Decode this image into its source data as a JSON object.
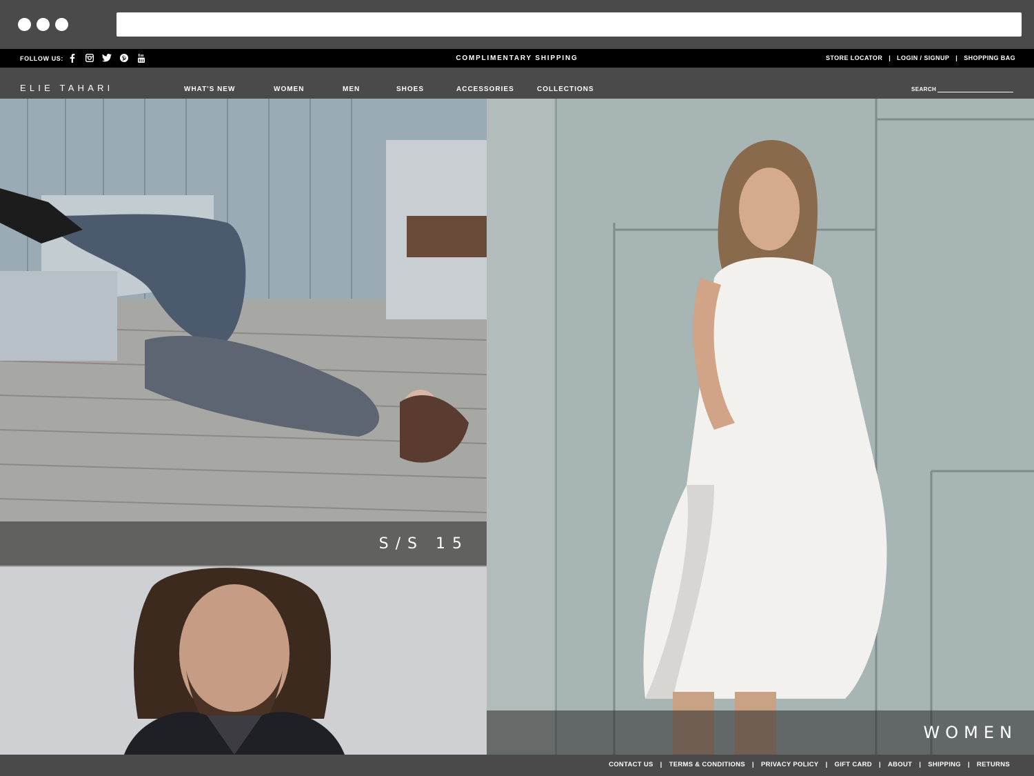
{
  "topbar": {
    "follow_label": "FOLLOW US:",
    "social_icons": [
      "facebook-icon",
      "instagram-icon",
      "twitter-icon",
      "pinterest-icon",
      "youtube-icon"
    ],
    "promo": "COMPLIMENTARY SHIPPING",
    "links": [
      "STORE LOCATOR",
      "LOGIN / SIGNUP",
      "SHOPPING BAG"
    ]
  },
  "header": {
    "logo": "ELIE TAHARI",
    "nav": [
      "WHAT'S NEW",
      "WOMEN",
      "MEN",
      "SHOES",
      "ACCESSORIES",
      "COLLECTIONS"
    ],
    "search_label": "SEARCH"
  },
  "panels": {
    "ss15": "S/S 15",
    "women": "WOMEN"
  },
  "footer": {
    "links": [
      "CONTACT US",
      "TERMS & CONDITIONS",
      "PRIVACY POLICY",
      "GIFT CARD",
      "ABOUT",
      "SHIPPING",
      "RETURNS"
    ]
  },
  "colors": {
    "chrome": "#4a4a4a",
    "topbar": "#000000",
    "text": "#ffffff"
  }
}
